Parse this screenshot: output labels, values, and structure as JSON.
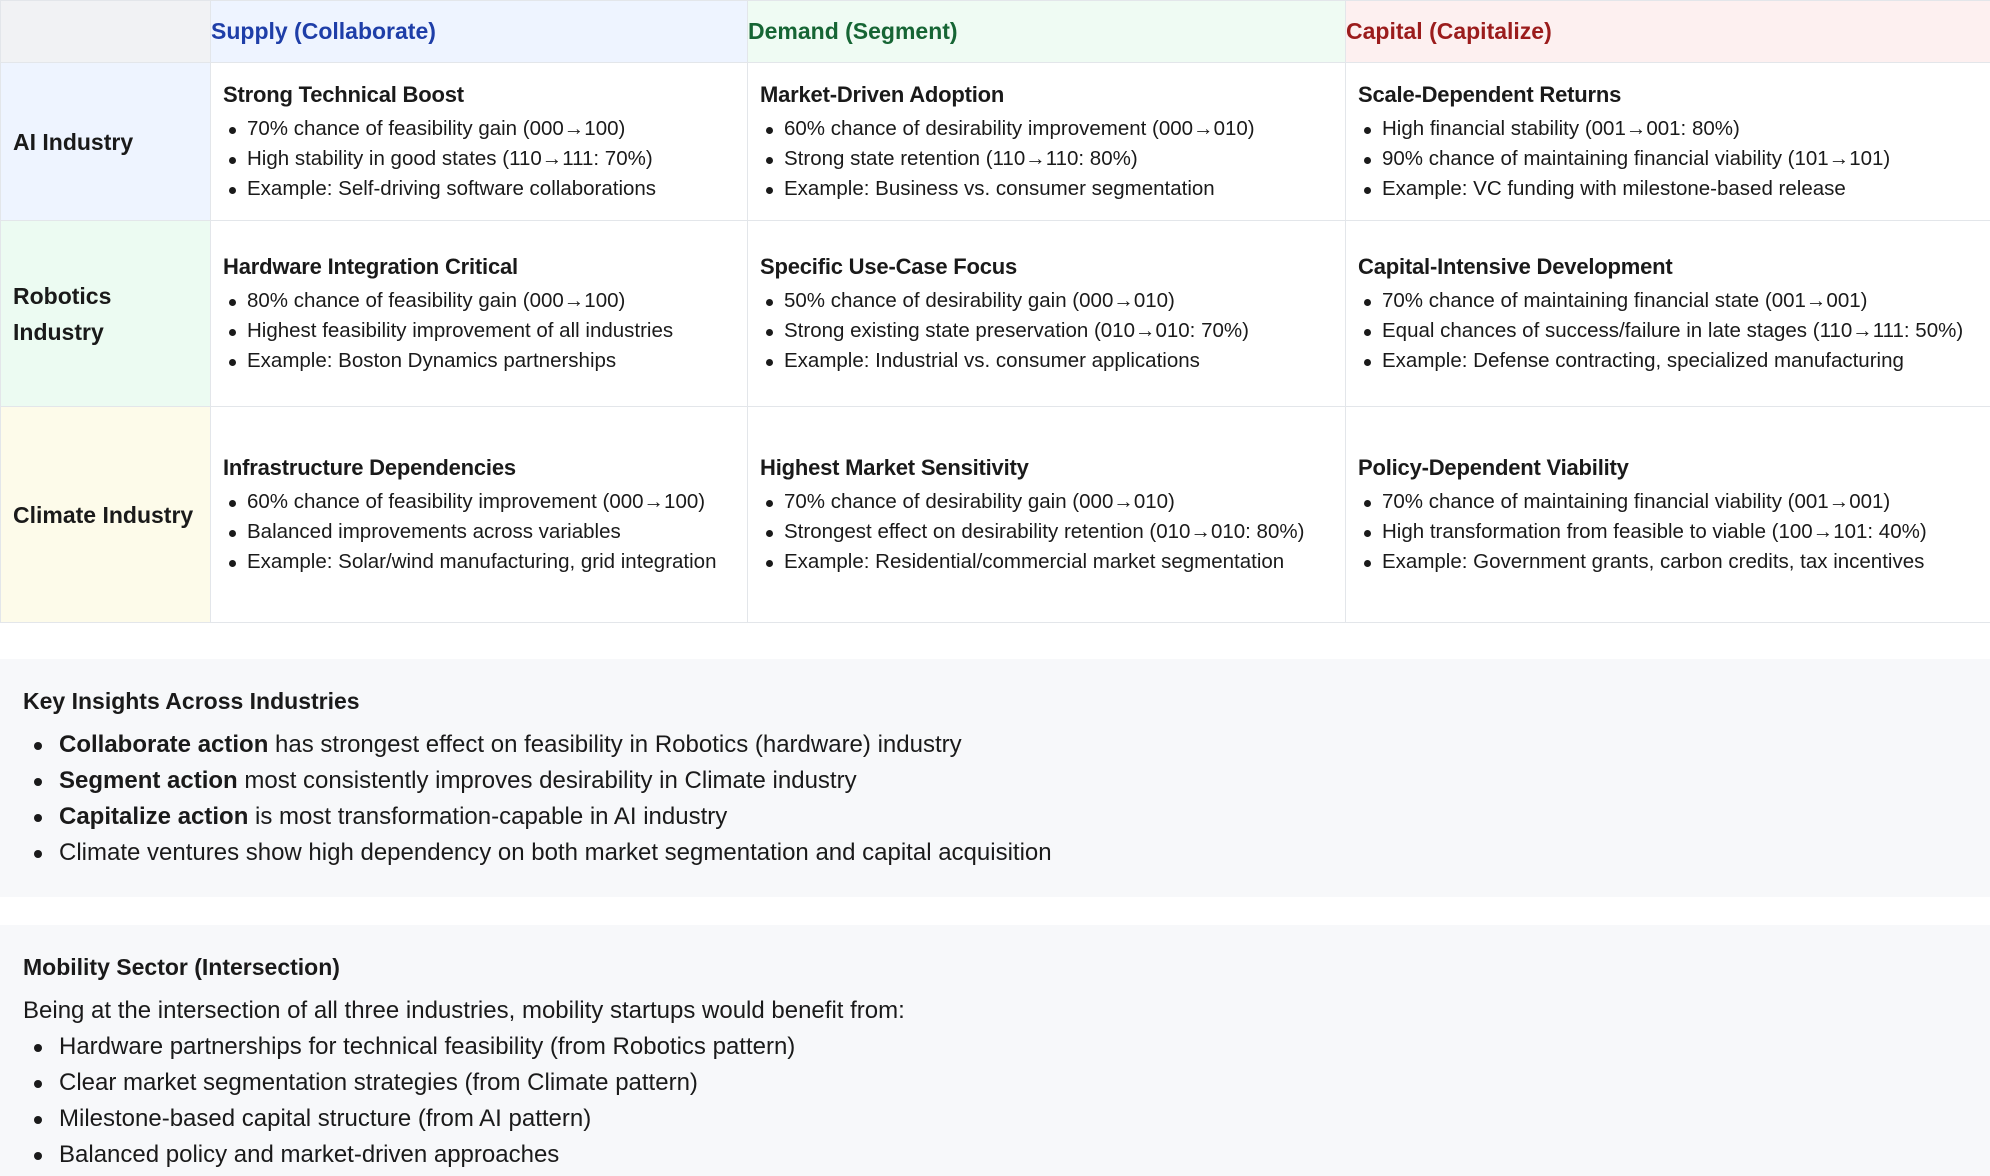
{
  "matrix": {
    "headers": {
      "supply": "Supply (Collaborate)",
      "demand": "Demand (Segment)",
      "capital": "Capital (Capitalize)"
    },
    "header_colors": {
      "supply": "#1e3ea8",
      "demand": "#166534",
      "capital": "#9b1c1c"
    },
    "rows": [
      {
        "label": "AI Industry",
        "supply": {
          "title": "Strong Technical Boost",
          "bullets": [
            "70% chance of feasibility gain (000→100)",
            "High stability in good states (110→111: 70%)",
            "Example: Self-driving software collaborations"
          ]
        },
        "demand": {
          "title": "Market-Driven Adoption",
          "bullets": [
            "60% chance of desirability improvement (000→010)",
            "Strong state retention (110→110: 80%)",
            "Example: Business vs. consumer segmentation"
          ]
        },
        "capital": {
          "title": "Scale-Dependent Returns",
          "bullets": [
            "High financial stability (001→001: 80%)",
            "90% chance of maintaining financial viability (101→101)",
            "Example: VC funding with milestone-based release"
          ]
        }
      },
      {
        "label": "Robotics Industry",
        "supply": {
          "title": "Hardware Integration Critical",
          "bullets": [
            "80% chance of feasibility gain (000→100)",
            "Highest feasibility improvement of all industries",
            "Example: Boston Dynamics partnerships"
          ]
        },
        "demand": {
          "title": "Specific Use-Case Focus",
          "bullets": [
            "50% chance of desirability gain (000→010)",
            "Strong existing state preservation (010→010: 70%)",
            "Example: Industrial vs. consumer applications"
          ]
        },
        "capital": {
          "title": "Capital-Intensive Development",
          "bullets": [
            "70% chance of maintaining financial state (001→001)",
            "Equal chances of success/failure in late stages (110→111: 50%)",
            "Example: Defense contracting, specialized manufacturing"
          ]
        }
      },
      {
        "label": "Climate Industry",
        "supply": {
          "title": "Infrastructure Dependencies",
          "bullets": [
            "60% chance of feasibility improvement (000→100)",
            "Balanced improvements across variables",
            "Example: Solar/wind manufacturing, grid integration"
          ]
        },
        "demand": {
          "title": "Highest Market Sensitivity",
          "bullets": [
            "70% chance of desirability gain (000→010)",
            "Strongest effect on desirability retention (010→010: 80%)",
            "Example: Residential/commercial market segmentation"
          ]
        },
        "capital": {
          "title": "Policy-Dependent Viability",
          "bullets": [
            "70% chance of maintaining financial viability (001→001)",
            "High transformation from feasible to viable (100→101: 40%)",
            "Example: Government grants, carbon credits, tax incentives"
          ]
        }
      }
    ]
  },
  "insights": {
    "title": "Key Insights Across Industries",
    "items": [
      {
        "bold": "Collaborate action",
        "text": " has strongest effect on feasibility in Robotics (hardware) industry"
      },
      {
        "bold": "Segment action",
        "text": " most consistently improves desirability in Climate industry"
      },
      {
        "bold": "Capitalize action",
        "text": " is most transformation-capable in AI industry"
      },
      {
        "bold": "",
        "text": "Climate ventures show high dependency on both market segmentation and capital acquisition"
      }
    ]
  },
  "mobility": {
    "title": "Mobility Sector (Intersection)",
    "intro": "Being at the intersection of all three industries, mobility startups would benefit from:",
    "items": [
      "Hardware partnerships for technical feasibility (from Robotics pattern)",
      "Clear market segmentation strategies (from Climate pattern)",
      "Milestone-based capital structure (from AI pattern)",
      "Balanced policy and market-driven approaches"
    ]
  }
}
